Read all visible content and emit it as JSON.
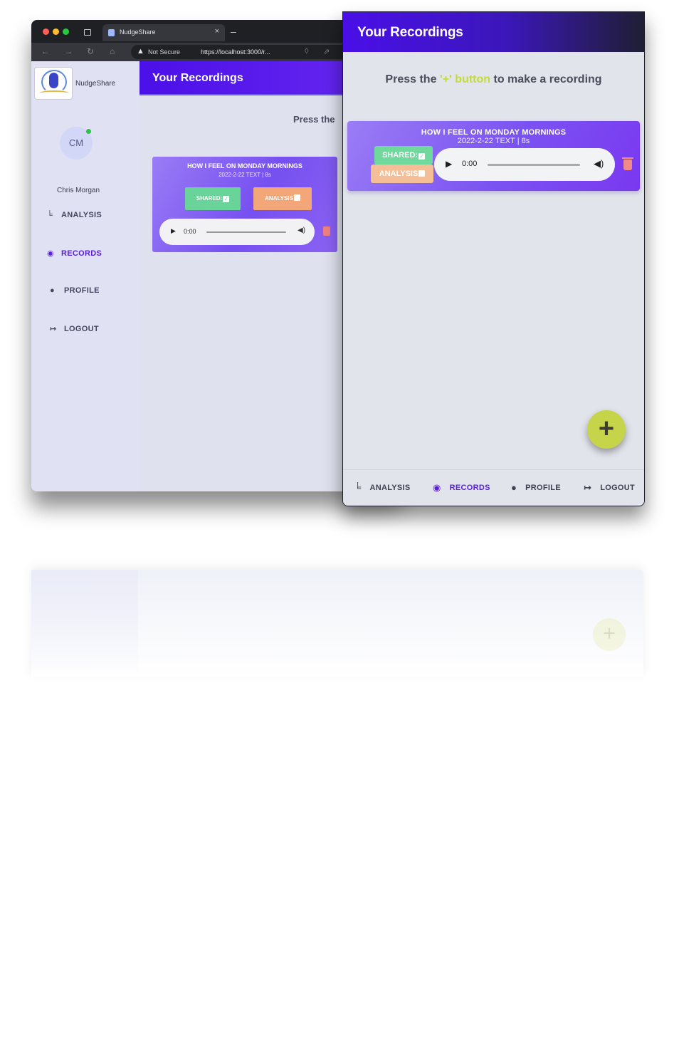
{
  "colors": {
    "header_gradient_start": "#4a0fe8",
    "accent_purple": "#5b1fe0",
    "highlight_lime": "#c3d93e",
    "shared_green": "#6fd89c",
    "analysis_orange": "#f4bf96",
    "fab": "#c6d44a",
    "trash_red": "#f08a8a"
  },
  "desktop": {
    "tab": {
      "title": "NudgeShare",
      "close": "×"
    },
    "url": {
      "not_secure": "Not Secure",
      "address": "https://localhost:3000/r..."
    },
    "sidebar": {
      "brand": "NudgeShare",
      "avatar_initials": "CM",
      "user_name": "Chris Morgan",
      "items": [
        {
          "label": "ANALYSIS",
          "icon": "chart-icon"
        },
        {
          "label": "RECORDS",
          "icon": "disc-icon"
        },
        {
          "label": "PROFILE",
          "icon": "user-icon"
        },
        {
          "label": "LOGOUT",
          "icon": "logout-icon"
        }
      ]
    },
    "header_title": "Your Recordings",
    "press_hint": "Press the",
    "recording": {
      "title": "HOW I FEEL ON MONDAY MORNINGS",
      "meta": "2022-2-22 TEXT | 8s",
      "shared_label": "SHARED:",
      "analysis_label": "ANALYSIS",
      "time": "0:00"
    }
  },
  "mobile": {
    "header_title": "Your Recordings",
    "press": {
      "before": "Press the ",
      "highlight": "'+' button",
      "after": " to make a recording"
    },
    "recording": {
      "title": "HOW I FEEL ON MONDAY MORNINGS",
      "meta": "2022-2-22 TEXT | 8s",
      "shared_label": "SHARED:",
      "shared_checked": true,
      "analysis_label": "ANALYSIS",
      "analysis_checked": false,
      "time": "0:00"
    },
    "fab_label": "+",
    "bottom_nav": [
      {
        "label": "ANALYSIS",
        "icon": "chart-icon"
      },
      {
        "label": "RECORDS",
        "icon": "disc-icon",
        "active": true
      },
      {
        "label": "PROFILE",
        "icon": "user-icon"
      },
      {
        "label": "LOGOUT",
        "icon": "logout-icon"
      }
    ]
  }
}
